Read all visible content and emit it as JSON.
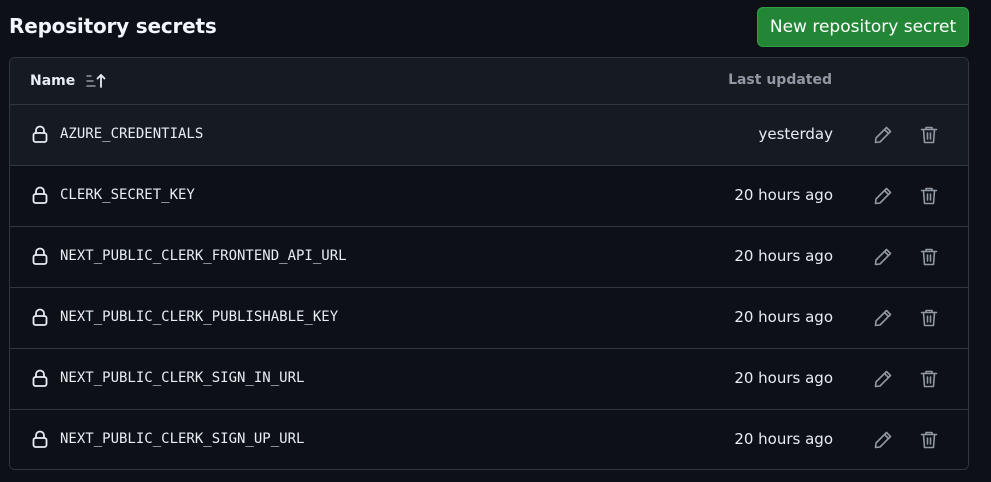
{
  "header": {
    "title": "Repository secrets",
    "new_button_label": "New repository secret"
  },
  "table": {
    "columns": {
      "name": "Name",
      "last_updated": "Last updated"
    },
    "rows": [
      {
        "name": "AZURE_CREDENTIALS",
        "updated": "yesterday"
      },
      {
        "name": "CLERK_SECRET_KEY",
        "updated": "20 hours ago"
      },
      {
        "name": "NEXT_PUBLIC_CLERK_FRONTEND_API_URL",
        "updated": "20 hours ago"
      },
      {
        "name": "NEXT_PUBLIC_CLERK_PUBLISHABLE_KEY",
        "updated": "20 hours ago"
      },
      {
        "name": "NEXT_PUBLIC_CLERK_SIGN_IN_URL",
        "updated": "20 hours ago"
      },
      {
        "name": "NEXT_PUBLIC_CLERK_SIGN_UP_URL",
        "updated": "20 hours ago"
      }
    ]
  },
  "icons": {
    "sort": "sort-ascending-icon",
    "lock": "lock-icon",
    "edit": "pencil-icon",
    "delete": "trash-icon"
  },
  "colors": {
    "background": "#0d1117",
    "header_bg": "#161b22",
    "border": "#30363d",
    "primary_button": "#238636",
    "text": "#e6edf3",
    "muted_text": "#9198a1"
  }
}
